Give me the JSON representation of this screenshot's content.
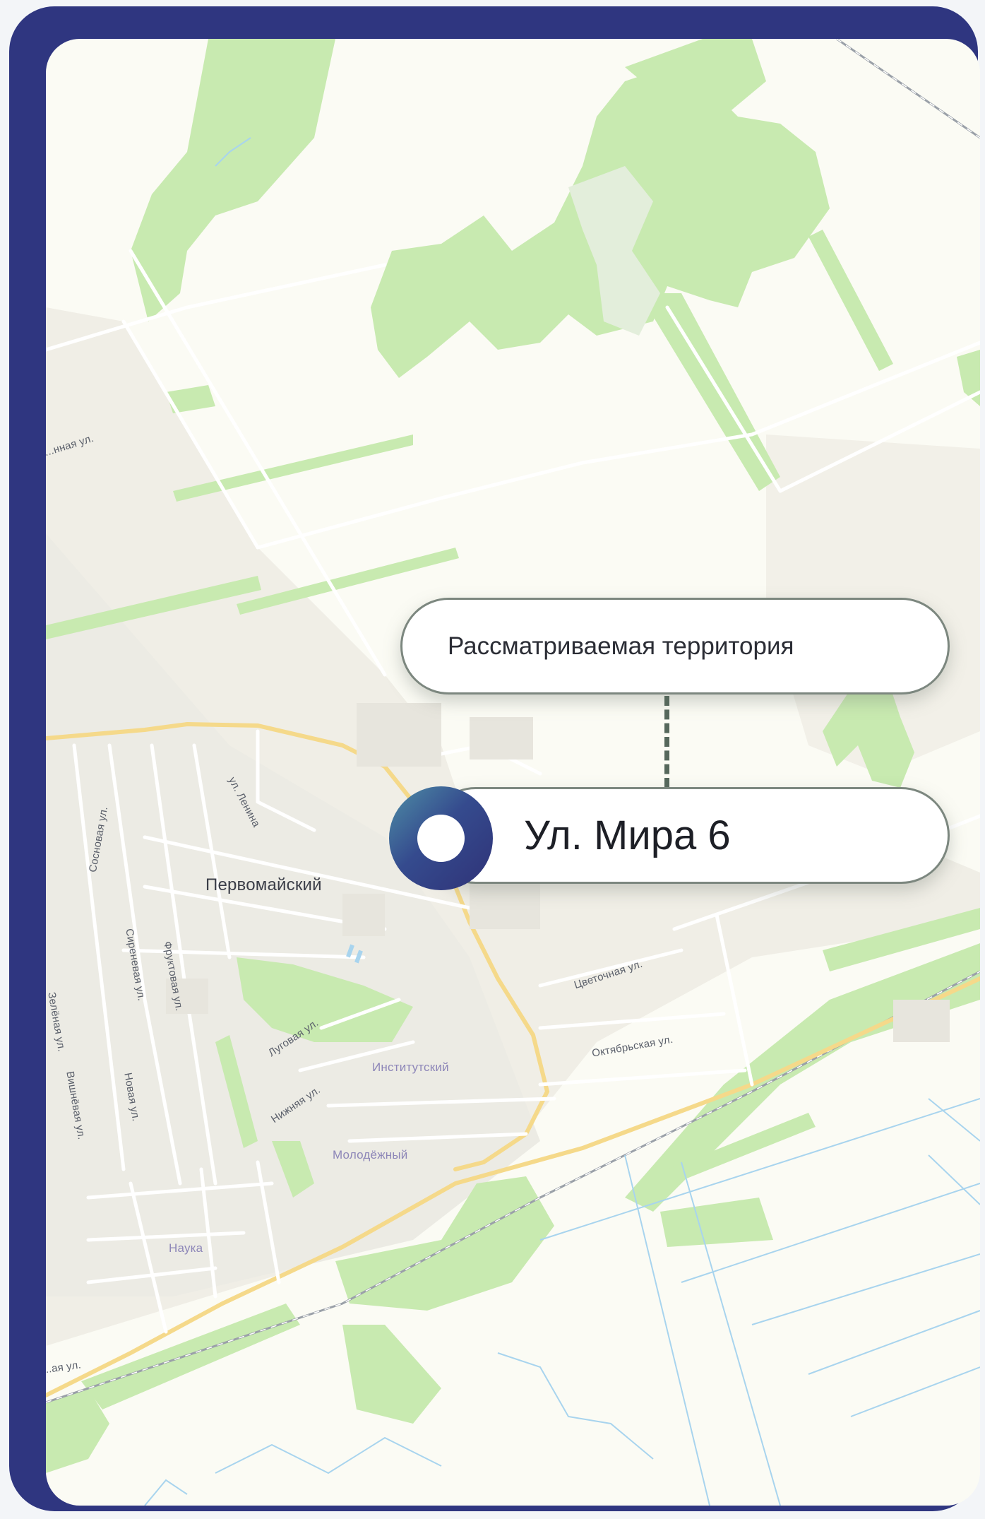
{
  "map": {
    "callout": {
      "area_label": "Рассматриваемая  территория",
      "address": "Ул. Мира 6"
    },
    "places": {
      "town": "Первомайский",
      "institutsky": "Институтский",
      "molodezhny": "Молодёжный",
      "nauka": "Наука"
    },
    "streets": {
      "top_left": "...нная ул.",
      "lenina": "ул. Ленина",
      "sosnovaya": "Сосновая ул.",
      "sirenevaya": "Сиреневая ул.",
      "fruktovaya": "Фруктовая ул.",
      "zelenaya": "Зелёная ул.",
      "vishnevaya": "Вишнёвая ул.",
      "novaya": "Новая ул.",
      "lugovaya": "Луговая ул.",
      "nizhnyaya": "Нижняя ул.",
      "tsvetochnaya": "Цветочная ул.",
      "oktyabrskaya": "Октябрьская ул.",
      "bottom_left": "...ая ул."
    },
    "colors": {
      "frame": "#2f3680",
      "map_background": "#fbfbf4",
      "forest": "#c8eab0",
      "road_major": "#f5d98a",
      "water": "#a8d4ee",
      "pin_gradient": [
        "#4e8fa6",
        "#2f3277"
      ]
    },
    "icons": [
      "location-pin-icon"
    ]
  }
}
